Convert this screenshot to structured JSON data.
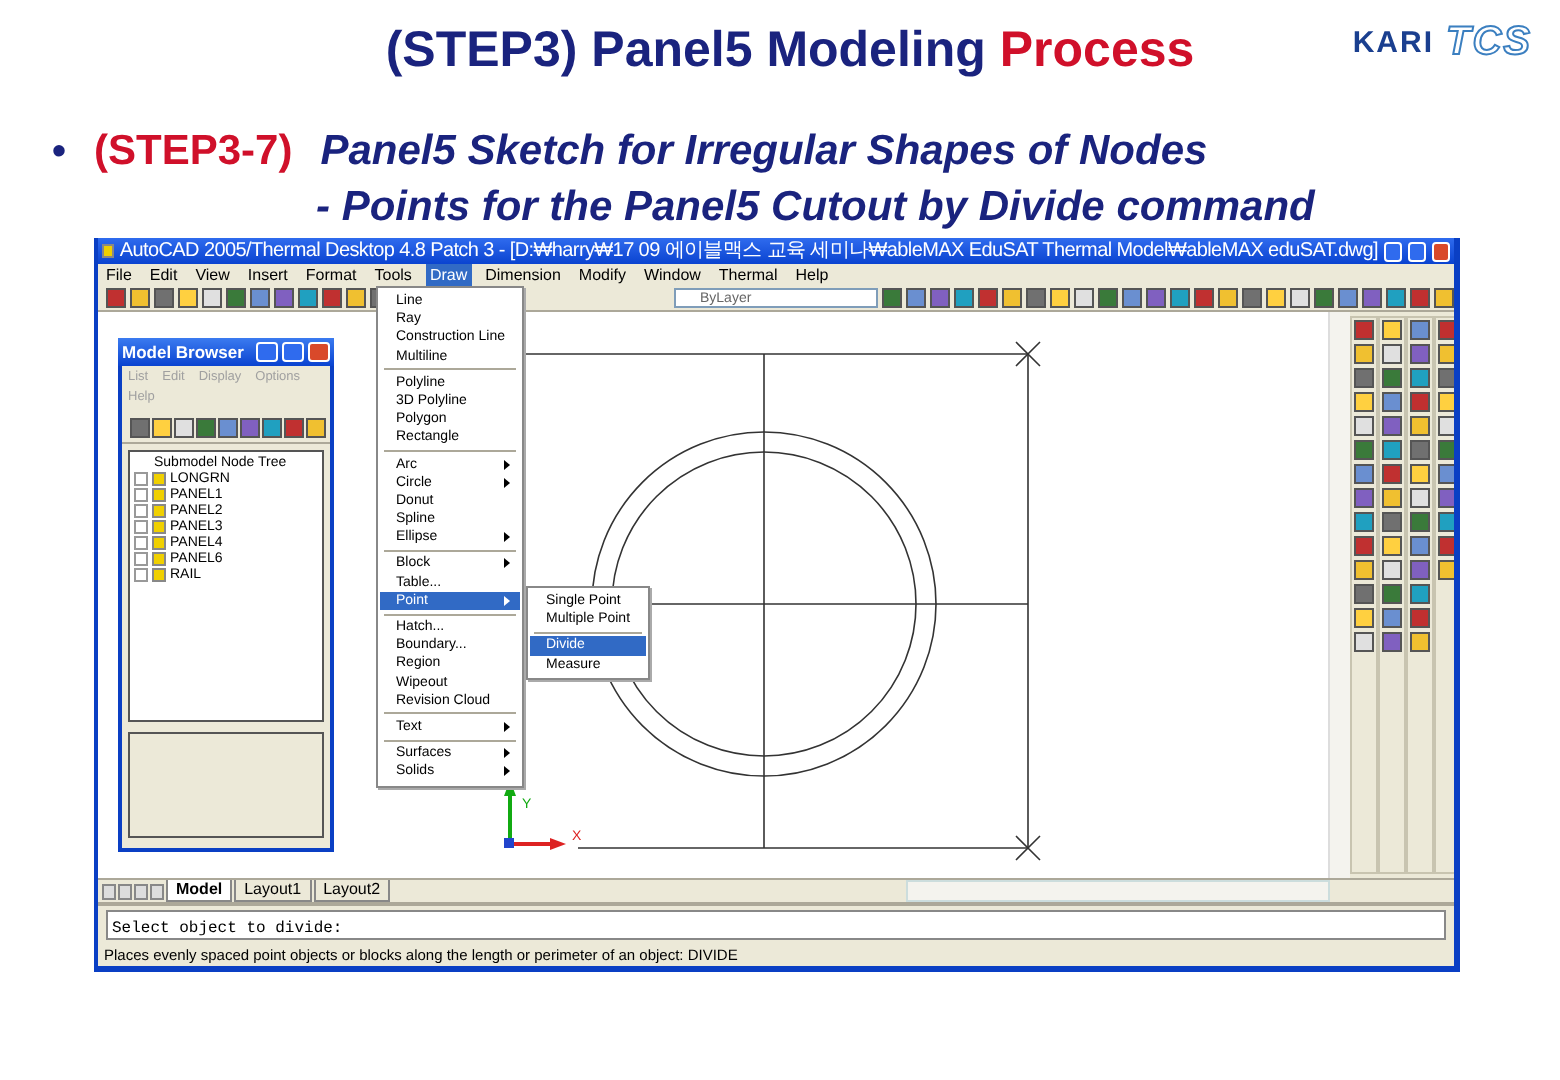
{
  "slide": {
    "title": "(STEP3) Panel5 Modeling",
    "title_highlight": "Process",
    "logos": [
      "KARI",
      "TCS"
    ],
    "bullet": {
      "marker": "•",
      "step": "(STEP3-7)",
      "text": "Panel5 Sketch for Irregular Shapes of Nodes",
      "subtext": "- Points for the Panel5 Cutout by Divide command"
    }
  },
  "window": {
    "title": "AutoCAD 2005/Thermal Desktop 4.8 Patch 3 - [D:₩harry₩17 09 에이블맥스 교육 세미나₩ableMAX EduSAT Thermal Model₩ableMAX eduSAT.dwg]",
    "menus": [
      {
        "label": "File",
        "selected": false
      },
      {
        "label": "Edit",
        "selected": false
      },
      {
        "label": "View",
        "selected": false
      },
      {
        "label": "Insert",
        "selected": false
      },
      {
        "label": "Format",
        "selected": false
      },
      {
        "label": "Tools",
        "selected": false
      },
      {
        "label": "Draw",
        "selected": true
      },
      {
        "label": "Dimension",
        "selected": false
      },
      {
        "label": "Modify",
        "selected": false
      },
      {
        "label": "Window",
        "selected": false
      },
      {
        "label": "Thermal",
        "selected": false
      },
      {
        "label": "Help",
        "selected": false
      }
    ],
    "layer_dropdown": "ByLayer",
    "draw_menu": [
      {
        "kind": "item",
        "label": "Line",
        "submenu": false,
        "selected": false
      },
      {
        "kind": "item",
        "label": "Ray",
        "submenu": false,
        "selected": false
      },
      {
        "kind": "item",
        "label": "Construction Line",
        "submenu": false,
        "selected": false
      },
      {
        "kind": "item",
        "label": "Multiline",
        "submenu": false,
        "selected": false
      },
      {
        "kind": "separator"
      },
      {
        "kind": "item",
        "label": "Polyline",
        "submenu": false,
        "selected": false
      },
      {
        "kind": "item",
        "label": "3D Polyline",
        "submenu": false,
        "selected": false
      },
      {
        "kind": "item",
        "label": "Polygon",
        "submenu": false,
        "selected": false
      },
      {
        "kind": "item",
        "label": "Rectangle",
        "submenu": false,
        "selected": false
      },
      {
        "kind": "separator"
      },
      {
        "kind": "item",
        "label": "Arc",
        "submenu": true,
        "selected": false
      },
      {
        "kind": "item",
        "label": "Circle",
        "submenu": true,
        "selected": false
      },
      {
        "kind": "item",
        "label": "Donut",
        "submenu": false,
        "selected": false
      },
      {
        "kind": "item",
        "label": "Spline",
        "submenu": false,
        "selected": false
      },
      {
        "kind": "item",
        "label": "Ellipse",
        "submenu": true,
        "selected": false
      },
      {
        "kind": "separator"
      },
      {
        "kind": "item",
        "label": "Block",
        "submenu": true,
        "selected": false
      },
      {
        "kind": "item",
        "label": "Table...",
        "submenu": false,
        "selected": false
      },
      {
        "kind": "item",
        "label": "Point",
        "submenu": true,
        "selected": true
      },
      {
        "kind": "separator"
      },
      {
        "kind": "item",
        "label": "Hatch...",
        "submenu": false,
        "selected": false
      },
      {
        "kind": "item",
        "label": "Boundary...",
        "submenu": false,
        "selected": false
      },
      {
        "kind": "item",
        "label": "Region",
        "submenu": false,
        "selected": false
      },
      {
        "kind": "item",
        "label": "Wipeout",
        "submenu": false,
        "selected": false
      },
      {
        "kind": "item",
        "label": "Revision Cloud",
        "submenu": false,
        "selected": false
      },
      {
        "kind": "separator"
      },
      {
        "kind": "item",
        "label": "Text",
        "submenu": true,
        "selected": false
      },
      {
        "kind": "separator"
      },
      {
        "kind": "item",
        "label": "Surfaces",
        "submenu": true,
        "selected": false
      },
      {
        "kind": "item",
        "label": "Solids",
        "submenu": true,
        "selected": false
      }
    ],
    "point_submenu": [
      {
        "kind": "item",
        "label": "Single Point",
        "selected": false
      },
      {
        "kind": "item",
        "label": "Multiple Point",
        "selected": false
      },
      {
        "kind": "separator"
      },
      {
        "kind": "item",
        "label": "Divide",
        "selected": true
      },
      {
        "kind": "item",
        "label": "Measure",
        "selected": false
      }
    ],
    "model_browser": {
      "title": "Model Browser",
      "menus": [
        {
          "label": "List",
          "disabled": true
        },
        {
          "label": "Edit",
          "disabled": true
        },
        {
          "label": "Display",
          "disabled": true
        },
        {
          "label": "Options",
          "disabled": true
        },
        {
          "label": "Help",
          "disabled": true
        }
      ],
      "tree_title": "Submodel Node Tree",
      "tree": [
        {
          "label": "LONGRN",
          "expanded": false
        },
        {
          "label": "PANEL1",
          "expanded": false
        },
        {
          "label": "PANEL2",
          "expanded": false
        },
        {
          "label": "PANEL3",
          "expanded": false
        },
        {
          "label": "PANEL4",
          "expanded": false
        },
        {
          "label": "PANEL6",
          "expanded": false
        },
        {
          "label": "RAIL",
          "expanded": false
        }
      ]
    },
    "ucs": {
      "x": "X",
      "y": "Y"
    },
    "layout_tabs": [
      {
        "label": "Model",
        "selected": true
      },
      {
        "label": "Layout1",
        "selected": false
      },
      {
        "label": "Layout2",
        "selected": false
      }
    ],
    "command_line": "Select object to divide:",
    "status_bar": "Places evenly spaced point objects or blocks along the length or perimeter of an object:  DIVIDE"
  }
}
